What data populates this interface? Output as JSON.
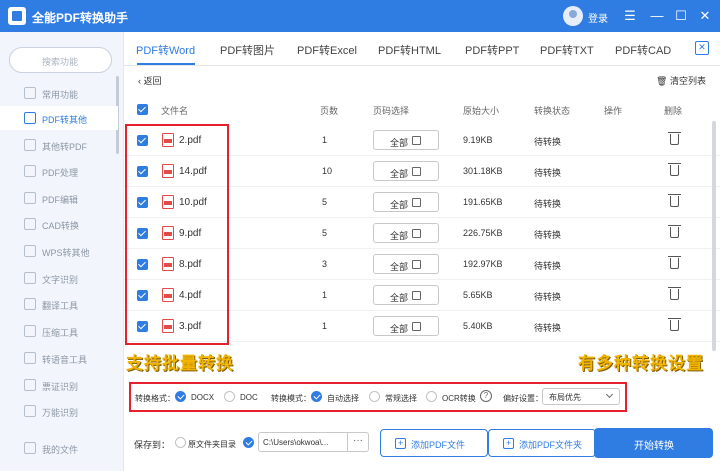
{
  "window": {
    "title": "全能PDF转换助手",
    "login": "登录",
    "menu_glyph": "☰",
    "minimize_glyph": "—",
    "maximize_glyph": "☐",
    "close_glyph": "✕"
  },
  "sidebar": {
    "search_placeholder": "搜索功能",
    "items": [
      {
        "label": "常用功能"
      },
      {
        "label": "PDF转其他"
      },
      {
        "label": "其他转PDF"
      },
      {
        "label": "PDF处理"
      },
      {
        "label": "PDF编辑"
      },
      {
        "label": "CAD转换"
      },
      {
        "label": "WPS转其他"
      },
      {
        "label": "文字识别"
      },
      {
        "label": "翻译工具"
      },
      {
        "label": "压缩工具"
      },
      {
        "label": "转语音工具"
      },
      {
        "label": "票证识别"
      },
      {
        "label": "万能识别"
      },
      {
        "label": "我的文件"
      }
    ],
    "active_index": 1
  },
  "tabs": [
    "PDF转Word",
    "PDF转图片",
    "PDF转Excel",
    "PDF转HTML",
    "PDF转PPT",
    "PDF转TXT",
    "PDF转CAD"
  ],
  "active_tab": 0,
  "toolbar": {
    "back_label": "返回",
    "clear_label": "清空列表"
  },
  "table": {
    "headers": [
      "文件名",
      "页数",
      "页码选择",
      "原始大小",
      "转换状态",
      "操作",
      "删除"
    ],
    "rows": [
      {
        "name": "2.pdf",
        "pages": "1",
        "page_select": "全部",
        "size": "9.19KB",
        "status": "待转换"
      },
      {
        "name": "14.pdf",
        "pages": "10",
        "page_select": "全部",
        "size": "301.18KB",
        "status": "待转换"
      },
      {
        "name": "10.pdf",
        "pages": "5",
        "page_select": "全部",
        "size": "191.65KB",
        "status": "待转换"
      },
      {
        "name": "9.pdf",
        "pages": "5",
        "page_select": "全部",
        "size": "226.75KB",
        "status": "待转换"
      },
      {
        "name": "8.pdf",
        "pages": "3",
        "page_select": "全部",
        "size": "192.97KB",
        "status": "待转换"
      },
      {
        "name": "4.pdf",
        "pages": "1",
        "page_select": "全部",
        "size": "5.65KB",
        "status": "待转换"
      },
      {
        "name": "3.pdf",
        "pages": "1",
        "page_select": "全部",
        "size": "5.40KB",
        "status": "待转换"
      }
    ]
  },
  "annotations": {
    "batch": "支持批量转换",
    "settings": "有多种转换设置"
  },
  "settings": {
    "format_label": "转换格式：",
    "format_docx": "DOCX",
    "format_doc": "DOC",
    "mode_label": "转换模式：",
    "mode_auto": "自动选择",
    "mode_normal": "常规选择",
    "mode_ocr": "OCR转换",
    "pref_label": "偏好设置：",
    "pref_value": "布局优先"
  },
  "bottom": {
    "save_label": "保存到：",
    "source_dir": "原文件夹目录",
    "path_value": "C:\\Users\\okwoa\\...",
    "dots": "···",
    "add_pdf": "添加PDF文件",
    "add_folder": "添加PDF文件夹",
    "start": "开始转换"
  },
  "colors": {
    "accent": "#2f7ce3",
    "annotation_border": "#e6202e",
    "annotation_text": "#f2b400"
  }
}
